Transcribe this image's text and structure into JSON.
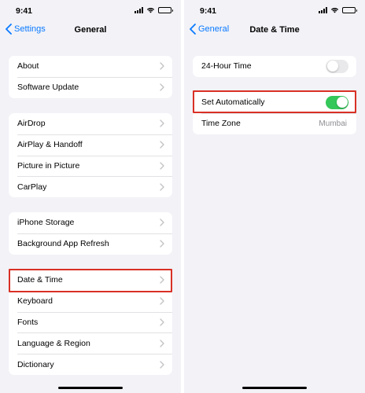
{
  "status": {
    "time": "9:41"
  },
  "left": {
    "nav": {
      "back_label": "Settings",
      "title": "General"
    },
    "groups": [
      {
        "items": [
          "About",
          "Software Update"
        ]
      },
      {
        "items": [
          "AirDrop",
          "AirPlay & Handoff",
          "Picture in Picture",
          "CarPlay"
        ]
      },
      {
        "items": [
          "iPhone Storage",
          "Background App Refresh"
        ]
      },
      {
        "items": [
          "Date & Time",
          "Keyboard",
          "Fonts",
          "Language & Region",
          "Dictionary"
        ]
      }
    ],
    "highlighted_item": "Date & Time"
  },
  "right": {
    "nav": {
      "back_label": "General",
      "title": "Date & Time"
    },
    "group1": {
      "twenty_four_hour": {
        "label": "24-Hour Time",
        "enabled": false
      }
    },
    "group2": {
      "set_automatically": {
        "label": "Set Automatically",
        "enabled": true
      },
      "time_zone": {
        "label": "Time Zone",
        "value": "Mumbai"
      }
    },
    "highlighted_item": "Set Automatically"
  },
  "colors": {
    "accent": "#0a7aff",
    "toggle_on": "#34c759",
    "toggle_off": "#e9e9eb",
    "highlight": "#d93025",
    "background": "#f2f2f7"
  },
  "icons": [
    "signal-icon",
    "wifi-icon",
    "battery-icon",
    "back-chevron-icon",
    "chevron-right-icon"
  ]
}
